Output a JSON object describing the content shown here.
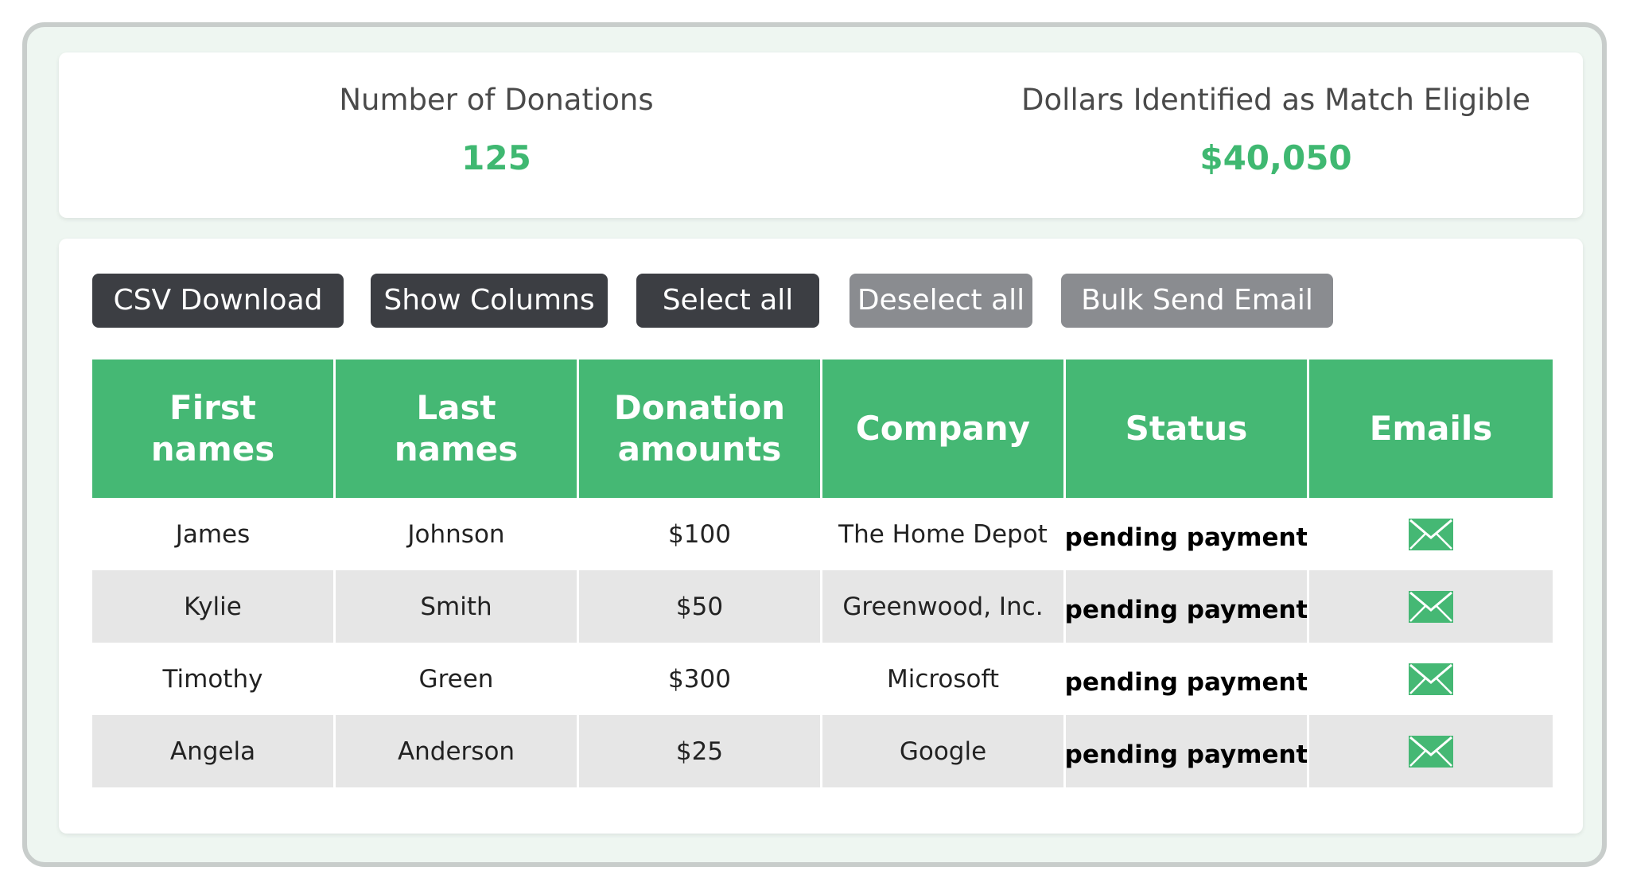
{
  "stats": {
    "donations_label": "Number of Donations",
    "donations_value": "125",
    "dollars_label": "Dollars Identified as Match Eligible",
    "dollars_value": "$40,050"
  },
  "toolbar": {
    "csv_label": "CSV Download",
    "columns_label": "Show Columns",
    "select_all_label": "Select all",
    "deselect_all_label": "Deselect all",
    "bulk_email_label": "Bulk Send Email"
  },
  "table": {
    "headers": [
      "First names",
      "Last names",
      "Donation amounts",
      "Company",
      "Status",
      "Emails"
    ],
    "rows": [
      {
        "first": "James",
        "last": "Johnson",
        "amount": "$100",
        "company": "The Home Depot",
        "status": "pending payment",
        "email_icon": "mail-icon"
      },
      {
        "first": "Kylie",
        "last": "Smith",
        "amount": "$50",
        "company": "Greenwood, Inc.",
        "status": "pending payment",
        "email_icon": "mail-icon"
      },
      {
        "first": "Timothy",
        "last": "Green",
        "amount": "$300",
        "company": "Microsoft",
        "status": "pending payment",
        "email_icon": "mail-icon"
      },
      {
        "first": "Angela",
        "last": "Anderson",
        "amount": "$25",
        "company": "Google",
        "status": "pending payment",
        "email_icon": "mail-icon"
      }
    ]
  },
  "colors": {
    "accent_green": "#45b874",
    "button_dark": "#3c3e43",
    "button_grey": "#8a8c90",
    "row_alt": "#e6e6e6"
  }
}
